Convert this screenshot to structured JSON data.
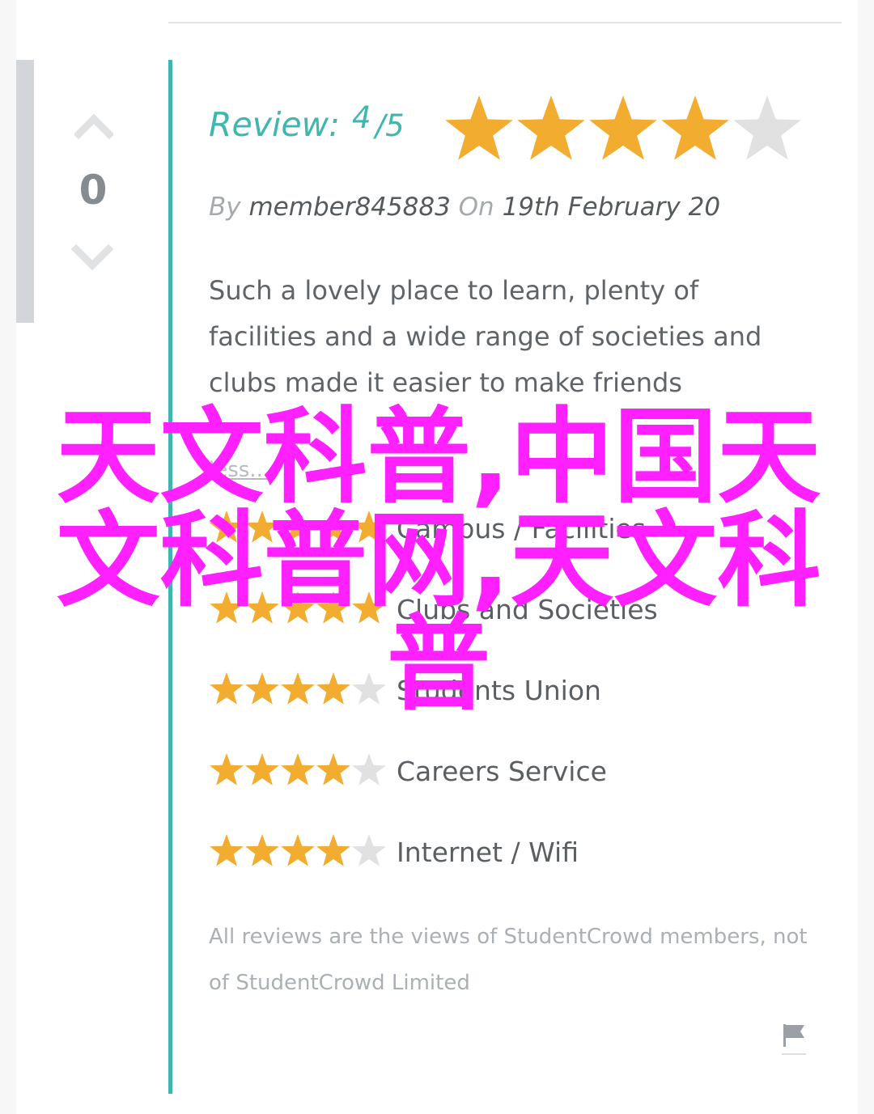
{
  "vote": {
    "count": "0"
  },
  "review": {
    "label": "Review:",
    "score": "4",
    "out_of": "/5",
    "rating": 4,
    "max_rating": 5,
    "by_label": "By",
    "author": "member845883",
    "on_label": "On",
    "date": "19th February 20",
    "text": "Such a lovely place to learn, plenty of facilities and a wide range of societies and clubs made it easier to make friends",
    "less_link": "less..."
  },
  "categories": [
    {
      "label": "Campus / Facilities",
      "rating": 5
    },
    {
      "label": "Clubs and Societies",
      "rating": 5
    },
    {
      "label": "Students Union",
      "rating": 4
    },
    {
      "label": "Careers Service",
      "rating": 4
    },
    {
      "label": "Internet / Wifi",
      "rating": 4
    }
  ],
  "footer": {
    "disclaimer": "All reviews are the views of StudentCrowd members, not of StudentCrowd Limited"
  },
  "overlay": {
    "watermark_text": "天文科普,中国天文科普网,天文科普"
  },
  "colors": {
    "accent": "#3fb7ad",
    "star_filled": "#f2ac2f",
    "star_empty": "#e1e1e1",
    "watermark": "#ff20ff"
  },
  "icons": {
    "vote_up": "chevron-up-icon",
    "vote_down": "chevron-down-icon",
    "report": "flag-icon"
  }
}
